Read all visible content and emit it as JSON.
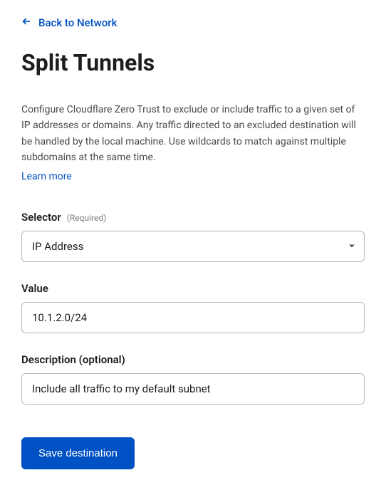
{
  "back_link": {
    "label": "Back to Network"
  },
  "page": {
    "title": "Split Tunnels",
    "description": "Configure Cloudflare Zero Trust to exclude or include traffic to a given set of IP addresses or domains. Any traffic directed to an excluded destination will be handled by the local machine. Use wildcards to match against multiple subdomains at the same time.",
    "learn_more": "Learn more"
  },
  "form": {
    "selector": {
      "label": "Selector",
      "required_hint": "(Required)",
      "selected": "IP Address"
    },
    "value": {
      "label": "Value",
      "current": "10.1.2.0/24"
    },
    "description": {
      "label": "Description (optional)",
      "current": "Include all traffic to my default subnet"
    },
    "submit_label": "Save destination"
  }
}
